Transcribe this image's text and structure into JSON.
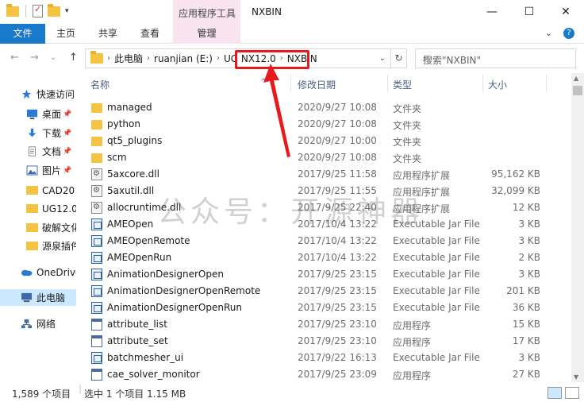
{
  "window": {
    "title": "NXBIN",
    "context_tab_group": "应用程序工具",
    "controls": {
      "minimize": "—",
      "maximize": "☐",
      "close": "✕"
    },
    "qat_dropdown": "▾"
  },
  "ribbon": {
    "tabs": [
      "文件",
      "主页",
      "共享",
      "查看",
      "管理"
    ],
    "expand": "⌄",
    "help": "?"
  },
  "nav": {
    "back": "←",
    "forward": "→",
    "recent": "⌄",
    "up": "↑",
    "breadcrumbs": [
      "此电脑",
      "ruanjian (E:)",
      "UG NX12.0",
      "NXBIN"
    ],
    "crumb_sep": "›",
    "address_dropdown": "⌄",
    "refresh": "↻",
    "search_placeholder": "搜索\"NXBIN\"",
    "search_icon": "⌕"
  },
  "sidebar": {
    "items": [
      {
        "label": "快速访问",
        "icon": "star-icon",
        "pinned": false
      },
      {
        "label": "桌面",
        "icon": "desktop-icon",
        "pinned": true
      },
      {
        "label": "下载",
        "icon": "download-icon",
        "pinned": true
      },
      {
        "label": "文档",
        "icon": "document-icon",
        "pinned": true
      },
      {
        "label": "图片",
        "icon": "pictures-icon",
        "pinned": true
      },
      {
        "label": "CAD20",
        "icon": "folder-icon",
        "pinned": false
      },
      {
        "label": "UG12.0",
        "icon": "folder-icon",
        "pinned": false
      },
      {
        "label": "破解文化",
        "icon": "folder-icon",
        "pinned": false
      },
      {
        "label": "源泉插件",
        "icon": "folder-icon",
        "pinned": false
      },
      {
        "label": "OneDrive",
        "icon": "cloud-icon",
        "pinned": false
      },
      {
        "label": "此电脑",
        "icon": "computer-icon",
        "pinned": false
      },
      {
        "label": "网络",
        "icon": "network-icon",
        "pinned": false
      }
    ],
    "pin_glyph": "📌"
  },
  "columns": {
    "name": "名称",
    "modified": "修改日期",
    "type": "类型",
    "size": "大小",
    "sort_indicator": "^"
  },
  "files": [
    {
      "name": "managed",
      "date": "2020/9/27 10:08",
      "type": "文件夹",
      "size": "",
      "kind": "folder"
    },
    {
      "name": "python",
      "date": "2020/9/27 10:08",
      "type": "文件夹",
      "size": "",
      "kind": "folder"
    },
    {
      "name": "qt5_plugins",
      "date": "2020/9/27 10:00",
      "type": "文件夹",
      "size": "",
      "kind": "folder"
    },
    {
      "name": "scm",
      "date": "2020/9/27 10:08",
      "type": "文件夹",
      "size": "",
      "kind": "folder"
    },
    {
      "name": "5axcore.dll",
      "date": "2017/9/25 11:58",
      "type": "应用程序扩展",
      "size": "95,162 KB",
      "kind": "dll"
    },
    {
      "name": "5axutil.dll",
      "date": "2017/9/25 11:55",
      "type": "应用程序扩展",
      "size": "32,099 KB",
      "kind": "dll"
    },
    {
      "name": "allocruntime.dll",
      "date": "2017/9/25 22:40",
      "type": "应用程序扩展",
      "size": "12 KB",
      "kind": "dll"
    },
    {
      "name": "AMEOpen",
      "date": "2017/10/4 13:22",
      "type": "Executable Jar File",
      "size": "3 KB",
      "kind": "jar"
    },
    {
      "name": "AMEOpenRemote",
      "date": "2017/10/4 13:22",
      "type": "Executable Jar File",
      "size": "3 KB",
      "kind": "jar"
    },
    {
      "name": "AMEOpenRun",
      "date": "2017/10/4 13:22",
      "type": "Executable Jar File",
      "size": "2 KB",
      "kind": "jar"
    },
    {
      "name": "AnimationDesignerOpen",
      "date": "2017/9/25 23:15",
      "type": "Executable Jar File",
      "size": "3 KB",
      "kind": "jar"
    },
    {
      "name": "AnimationDesignerOpenRemote",
      "date": "2017/9/25 23:15",
      "type": "Executable Jar File",
      "size": "201 KB",
      "kind": "jar"
    },
    {
      "name": "AnimationDesignerOpenRun",
      "date": "2017/9/25 23:15",
      "type": "Executable Jar File",
      "size": "36 KB",
      "kind": "jar"
    },
    {
      "name": "attribute_list",
      "date": "2017/9/25 23:10",
      "type": "应用程序",
      "size": "15 KB",
      "kind": "exe"
    },
    {
      "name": "attribute_set",
      "date": "2017/9/25 23:10",
      "type": "应用程序",
      "size": "17 KB",
      "kind": "exe"
    },
    {
      "name": "batchmesher_ui",
      "date": "2017/9/22 16:13",
      "type": "Executable Jar File",
      "size": "3 KB",
      "kind": "jar"
    },
    {
      "name": "cae_solver_monitor",
      "date": "2017/9/25 23:09",
      "type": "应用程序",
      "size": "27 KB",
      "kind": "exe"
    }
  ],
  "status": {
    "item_count": "1,589 个项目",
    "selection": "选中 1 个项目  1.15 MB"
  },
  "watermark": "公众号：开源神器",
  "accent": "#1979ca",
  "highlight_color": "#e8191c"
}
